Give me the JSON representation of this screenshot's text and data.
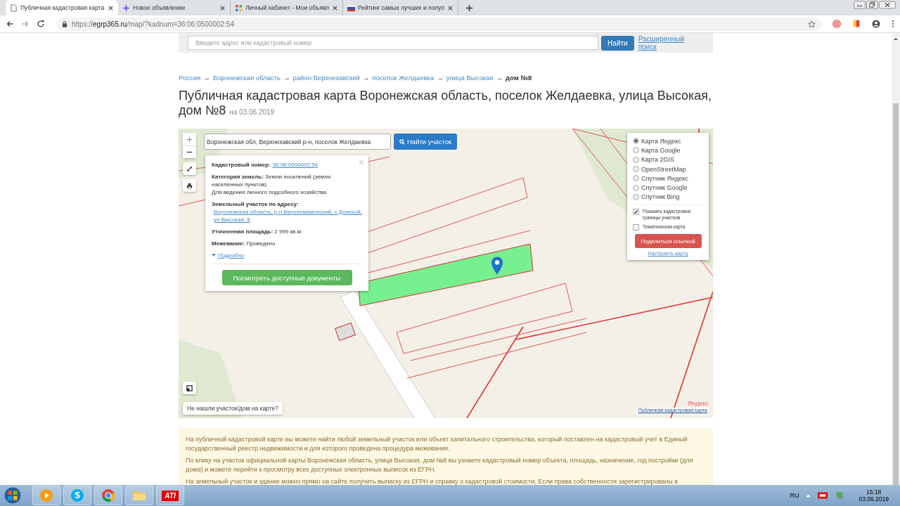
{
  "browser": {
    "tabs": [
      {
        "title": "Публичная кадастровая карта",
        "selected": true
      },
      {
        "title": "Новое объявление",
        "selected": false
      },
      {
        "title": "Личный кабинет - Мои объявл",
        "selected": false
      },
      {
        "title": "Рейтинг самых лучших и попул",
        "selected": false
      }
    ],
    "url": {
      "scheme": "https://",
      "domain": "egrp365.ru",
      "path": "/map/?kadnum=36:06:0500002:54"
    }
  },
  "top_search": {
    "placeholder": "Введите адрес или кадастровый номер",
    "button": "Найти",
    "link": "Расширенный поиск"
  },
  "breadcrumbs": {
    "separator": "→",
    "items": [
      {
        "label": "Россия",
        "current": false
      },
      {
        "label": "Воронежская область",
        "current": false
      },
      {
        "label": "район Верхнехавский",
        "current": false
      },
      {
        "label": "поселок Желдаевка",
        "current": false
      },
      {
        "label": "улица Высокая",
        "current": false
      },
      {
        "label": "дом №8",
        "current": true
      }
    ]
  },
  "heading": {
    "title": "Публичная кадастровая карта Воронежская область, поселок Желдаевка, улица Высокая, дом №8",
    "date": "на 03.06.2019"
  },
  "map": {
    "search_value": "Воронежская обл, Верхнехавский р-н, поселок Желдаевка",
    "search_button": "Найти участок",
    "popup": {
      "rows": [
        {
          "label": "Кадастровый номер:",
          "value": "36:06:0500002:54",
          "kind": "link"
        },
        {
          "label": "Категория земель:",
          "value": "Земли поселений (земли населенных пунктов)",
          "kind": "text",
          "note": "Для ведения личного подсобного хозяйства"
        },
        {
          "label": "Земельный участок по адресу:",
          "value": "Воронежская область, р-н Верхнемамонский, х Донской, ул Высокая, 8",
          "kind": "link"
        },
        {
          "label": "Уточненная площадь:",
          "value": "2 999 кв.м.",
          "kind": "text"
        },
        {
          "label": "Межевание:",
          "value": "Проведено",
          "kind": "text"
        }
      ],
      "more": "Подробно",
      "button": "Посмотреть доступные документы"
    },
    "layers": [
      {
        "label": "Карта Яндекс",
        "selected": true
      },
      {
        "label": "Карта Google",
        "selected": false
      },
      {
        "label": "Карта 2GIS",
        "selected": false
      },
      {
        "label": "OpenStreetMap",
        "selected": false
      },
      {
        "label": "Спутник Яндекс",
        "selected": false
      },
      {
        "label": "Спутник Google",
        "selected": false
      },
      {
        "label": "Спутник Bing",
        "selected": false
      }
    ],
    "options": [
      {
        "label": "Показать кадастровые границы участков",
        "checked": true
      },
      {
        "label": "Тематическая карта",
        "checked": false
      }
    ],
    "share_button": "Поделиться ссылкой",
    "settings_link": "Настроить карту",
    "not_found_button": "Не нашли участок/дом на карте?",
    "provider": "Яндекс",
    "attribution": "Публичная кадастровая карта"
  },
  "info": [
    "На публичной кадастровой карте вы можете найти любой земельный участок или объект капитального строительства, который поставлен на кадастровый учет в Единый государственный реестр недвижимости и для которого проведена процедура межевания.",
    "По клику на участок официальной карты Воронежская область, улица Высокая, дом №8 вы узнаете кадастровый номер объекта, площадь, назначение, год постройки (для дома) и можете перейти к просмотру всех доступных электронных выписок из ЕГРН.",
    "На земельный участок и здание можно прямо на сайте получить выписку из ЕГРН и справку о кадастровой стоимости. Если права собственности зарегистрированы в"
  ],
  "taskbar": {
    "apps": [
      {
        "kind": "media"
      },
      {
        "kind": "skype"
      },
      {
        "kind": "chrome"
      },
      {
        "kind": "folder"
      },
      {
        "kind": "ati",
        "label": "ATI"
      }
    ],
    "language": "RU",
    "time": "15:18",
    "date": "03.06.2019"
  }
}
